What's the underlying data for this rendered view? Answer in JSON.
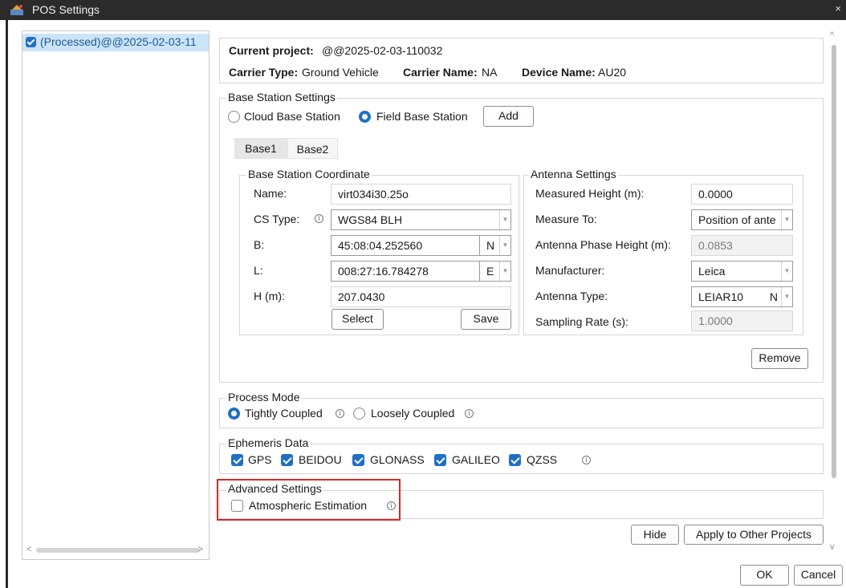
{
  "window": {
    "title": "POS Settings",
    "close_glyph": "×"
  },
  "tree": {
    "items": [
      {
        "label": "(Processed)@@2025-02-03-11",
        "checked": true
      }
    ],
    "scroll_left": "<",
    "scroll_right": ">"
  },
  "project": {
    "current_label": "Current project:",
    "current_value": "@@2025-02-03-110032",
    "carrier_type_label": "Carrier Type:",
    "carrier_type_value": "Ground Vehicle",
    "carrier_name_label": "Carrier Name:",
    "carrier_name_value": "NA",
    "device_name_label": "Device Name:",
    "device_name_value": "AU20"
  },
  "base_station": {
    "legend": "Base Station Settings",
    "cloud_label": "Cloud Base Station",
    "field_label": "Field Base Station",
    "selected": "Field Base Station",
    "add_label": "Add",
    "tabs": [
      "Base1",
      "Base2"
    ],
    "active_tab": "Base1",
    "coordinate": {
      "legend": "Base Station Coordinate",
      "name_label": "Name:",
      "name_value": "virt034i30.25o",
      "cs_type_label": "CS Type:",
      "cs_type_value": "WGS84 BLH",
      "b_label": "B:",
      "b_value": "45:08:04.252560",
      "b_hemisphere": "N",
      "l_label": "L:",
      "l_value": "008:27:16.784278",
      "l_hemisphere": "E",
      "h_label": "H (m):",
      "h_value": "207.0430",
      "select_label": "Select",
      "save_label": "Save"
    },
    "antenna": {
      "legend": "Antenna Settings",
      "measured_height_label": "Measured Height (m):",
      "measured_height_value": "0.0000",
      "measure_to_label": "Measure To:",
      "measure_to_value": "Position of ante",
      "phase_height_label": "Antenna Phase Height (m):",
      "phase_height_value": "0.0853",
      "manufacturer_label": "Manufacturer:",
      "manufacturer_value": "Leica",
      "antenna_type_label": "Antenna Type:",
      "antenna_type_value": "LEIAR10",
      "antenna_type_suffix": "N",
      "sampling_rate_label": "Sampling Rate (s):",
      "sampling_rate_value": "1.0000"
    },
    "remove_label": "Remove"
  },
  "process_mode": {
    "legend": "Process Mode",
    "tightly_label": "Tightly Coupled",
    "loosely_label": "Loosely Coupled",
    "selected": "Tightly Coupled"
  },
  "ephemeris": {
    "legend": "Ephemeris Data",
    "items": [
      {
        "label": "GPS",
        "checked": true
      },
      {
        "label": "BEIDOU",
        "checked": true
      },
      {
        "label": "GLONASS",
        "checked": true
      },
      {
        "label": "GALILEO",
        "checked": true
      },
      {
        "label": "QZSS",
        "checked": true
      }
    ]
  },
  "advanced": {
    "legend": "Advanced Settings",
    "atmospheric_label": "Atmospheric Estimation",
    "atmospheric_checked": false
  },
  "buttons": {
    "hide": "Hide",
    "apply": "Apply to Other Projects",
    "ok": "OK",
    "cancel": "Cancel"
  },
  "colors": {
    "accent": "#1f6fc5",
    "titlebar": "#2b2b2b",
    "highlight_frame": "#d32a2a",
    "tree_selection": "#cce4f7"
  },
  "icons": {
    "info": "info-circle-icon",
    "app": "pos-app-icon"
  }
}
